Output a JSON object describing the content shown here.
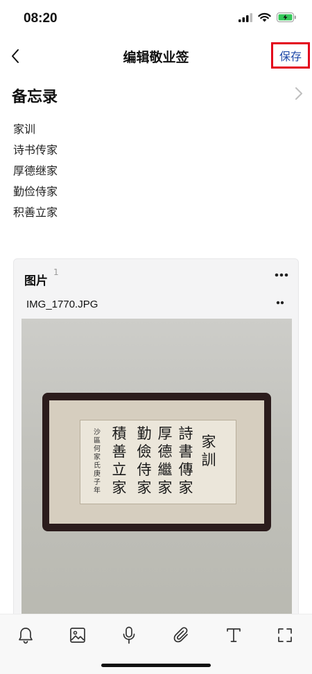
{
  "status_bar": {
    "time": "08:20"
  },
  "nav": {
    "title": "编辑敬业签",
    "save_label": "保存"
  },
  "section": {
    "title": "备忘录"
  },
  "memo_lines": [
    "家训",
    "诗书传家",
    "厚德继家",
    "勤俭侍家",
    "积善立家"
  ],
  "attachment": {
    "title": "图片",
    "count": "1",
    "file_name": "IMG_1770.JPG"
  },
  "artwork": {
    "columns": [
      "家訓",
      "詩書傳家",
      "厚德繼家",
      "勤儉侍家",
      "積善立家"
    ],
    "signature": "沙區何家氏庚子年"
  },
  "toolbar": {
    "icons": [
      "bell-icon",
      "image-icon",
      "microphone-icon",
      "paperclip-icon",
      "text-icon",
      "fullscreen-icon"
    ]
  },
  "colors": {
    "save_text": "#1f4aa8",
    "highlight_border": "#e3001b",
    "battery": "#34c759"
  }
}
